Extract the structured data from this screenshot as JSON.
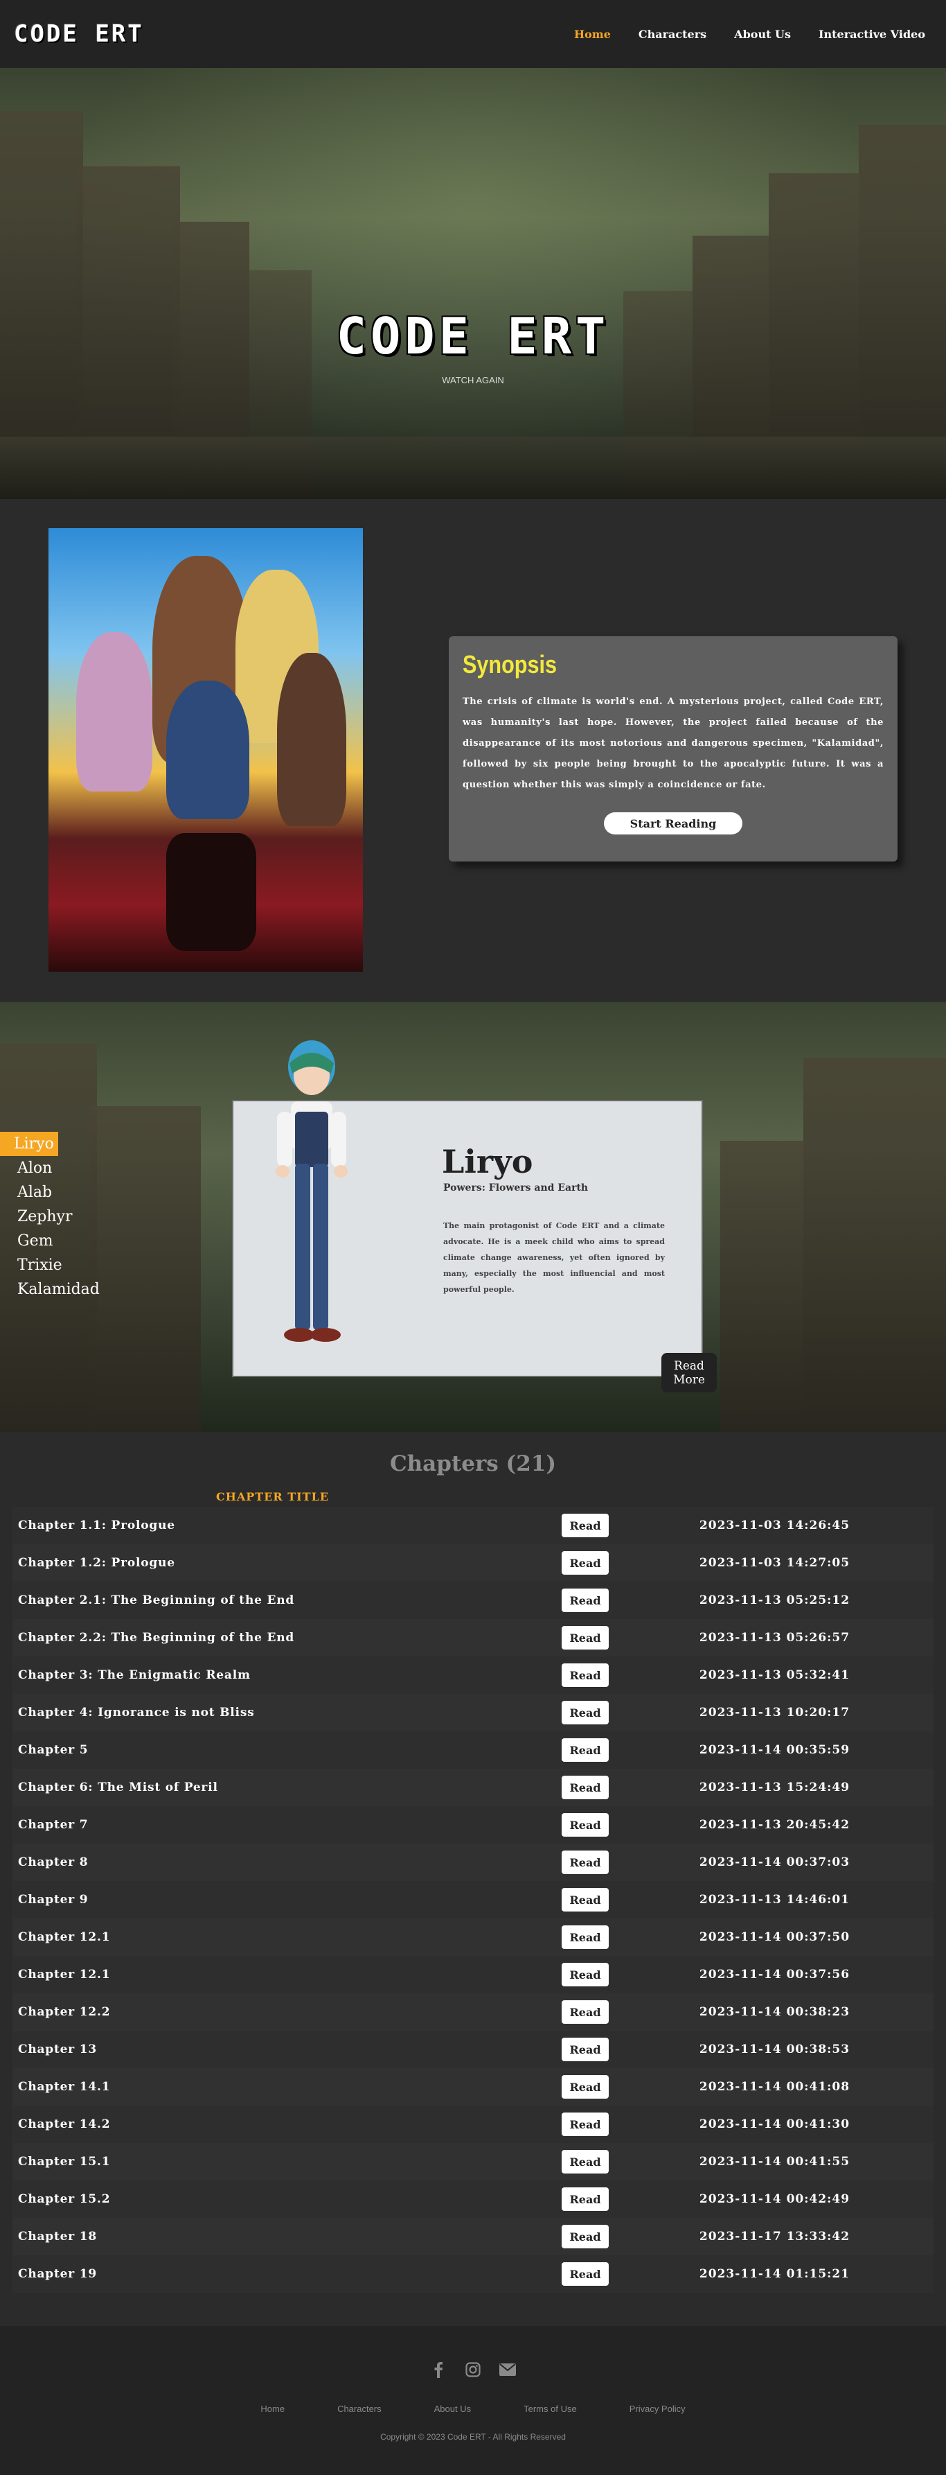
{
  "nav": {
    "logo": "CODE ERT",
    "links": [
      "Home",
      "Characters",
      "About Us",
      "Interactive Video"
    ]
  },
  "hero": {
    "title": "CODE ERT",
    "subtitle": "WATCH AGAIN"
  },
  "synopsis": {
    "title": "Synopsis",
    "text": "The crisis of climate is world's end. A mysterious project, called Code ERT, was humanity's last hope. However, the project failed because of the disappearance of its most notorious and dangerous specimen, \"Kalamidad\", followed by six people being brought to the apocalyptic future. It was a question whether this was simply a coincidence or fate.",
    "button": "Start Reading"
  },
  "characters": {
    "list": [
      "Liryo",
      "Alon",
      "Alab",
      "Zephyr",
      "Gem",
      "Trixie",
      "Kalamidad"
    ],
    "active_index": 0,
    "name": "Liryo",
    "powers": "Powers: Flowers and Earth",
    "description": "The main protagonist of Code ERT and a climate advocate. He is a meek child who aims to spread climate change awareness, yet often ignored by many, especially the most influencial and most powerful people.",
    "read_more": "Read More"
  },
  "chapters": {
    "heading": "Chapters (21)",
    "column_label": "CHAPTER TITLE",
    "read_label": "Read",
    "rows": [
      {
        "title": "Chapter 1.1: Prologue",
        "date": "2023-11-03 14:26:45"
      },
      {
        "title": "Chapter 1.2: Prologue",
        "date": "2023-11-03 14:27:05"
      },
      {
        "title": "Chapter 2.1: The Beginning of the End",
        "date": "2023-11-13 05:25:12"
      },
      {
        "title": "Chapter 2.2: The Beginning of the End",
        "date": "2023-11-13 05:26:57"
      },
      {
        "title": "Chapter 3: The Enigmatic Realm",
        "date": "2023-11-13 05:32:41"
      },
      {
        "title": "Chapter 4: Ignorance is not Bliss",
        "date": "2023-11-13 10:20:17"
      },
      {
        "title": "Chapter 5",
        "date": "2023-11-14 00:35:59"
      },
      {
        "title": "Chapter 6: The Mist of Peril",
        "date": "2023-11-13 15:24:49"
      },
      {
        "title": "Chapter 7",
        "date": "2023-11-13 20:45:42"
      },
      {
        "title": "Chapter 8",
        "date": "2023-11-14 00:37:03"
      },
      {
        "title": "Chapter 9",
        "date": "2023-11-13 14:46:01"
      },
      {
        "title": "Chapter 12.1",
        "date": "2023-11-14 00:37:50"
      },
      {
        "title": "Chapter 12.1",
        "date": "2023-11-14 00:37:56"
      },
      {
        "title": "Chapter 12.2",
        "date": "2023-11-14 00:38:23"
      },
      {
        "title": "Chapter 13",
        "date": "2023-11-14 00:38:53"
      },
      {
        "title": "Chapter 14.1",
        "date": "2023-11-14 00:41:08"
      },
      {
        "title": "Chapter 14.2",
        "date": "2023-11-14 00:41:30"
      },
      {
        "title": "Chapter 15.1",
        "date": "2023-11-14 00:41:55"
      },
      {
        "title": "Chapter 15.2",
        "date": "2023-11-14 00:42:49"
      },
      {
        "title": "Chapter 18",
        "date": "2023-11-17 13:33:42"
      },
      {
        "title": "Chapter 19",
        "date": "2023-11-14 01:15:21"
      }
    ]
  },
  "footer": {
    "socials": [
      "facebook-icon",
      "instagram-icon",
      "email-icon"
    ],
    "links": [
      "Home",
      "Characters",
      "About Us",
      "Terms of Use",
      "Privacy Policy"
    ],
    "copyright": "Copyright © 2023 Code ERT - All Rights Reserved"
  },
  "colors": {
    "accent": "#f5a623",
    "synopsis_title": "#f3e93c",
    "background": "#2b2b2b",
    "nav_background": "#232323"
  }
}
